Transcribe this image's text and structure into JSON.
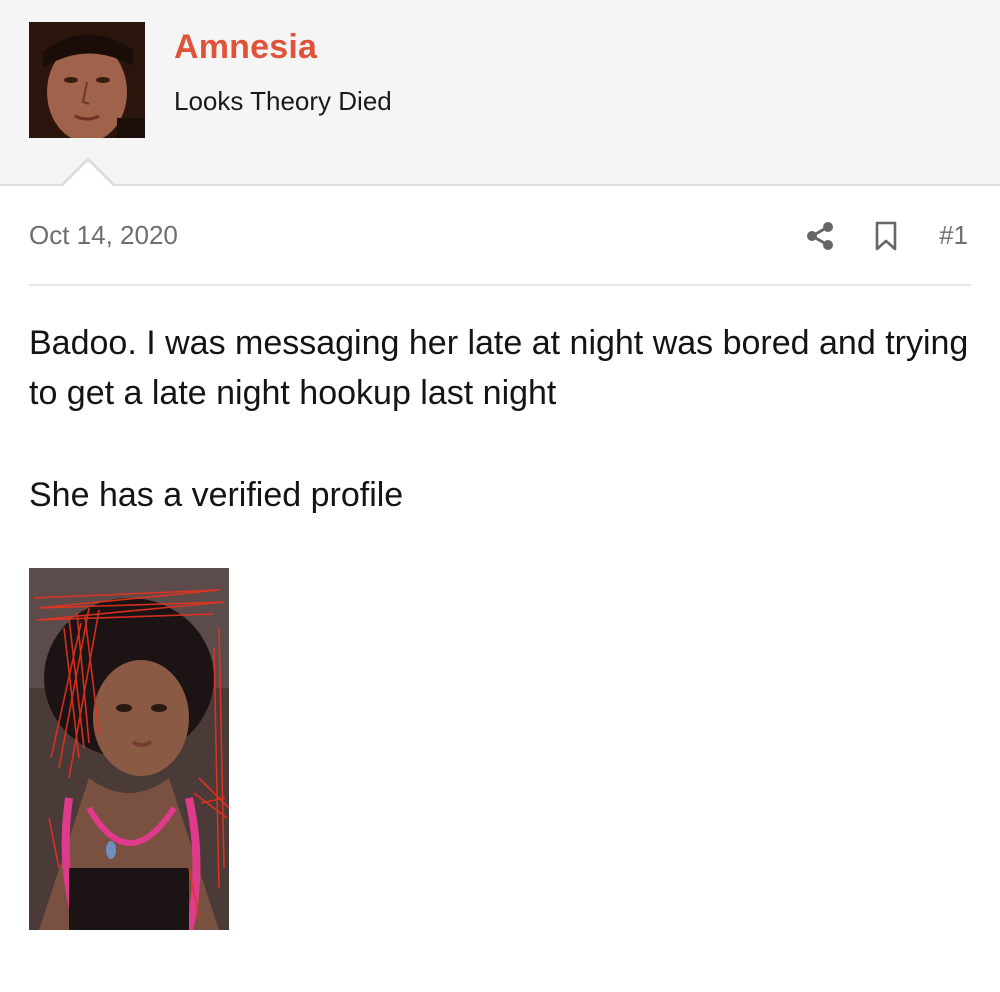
{
  "user": {
    "name": "Amnesia",
    "title": "Looks Theory Died",
    "avatar_icon": "user-avatar"
  },
  "post": {
    "date": "Oct 14, 2020",
    "number": "#1",
    "share_icon": "share-icon",
    "bookmark_icon": "bookmark-icon",
    "body": [
      "Badoo. I was messaging her late at night was bored and trying to get a late night hookup last night",
      "She has a verified profile"
    ],
    "attachment_icon": "photo-thumbnail"
  },
  "colors": {
    "username": "#e0533b",
    "header_bg": "#f5f5f5",
    "meta_text": "#6e6e6e",
    "scribble": "#e8321e"
  }
}
